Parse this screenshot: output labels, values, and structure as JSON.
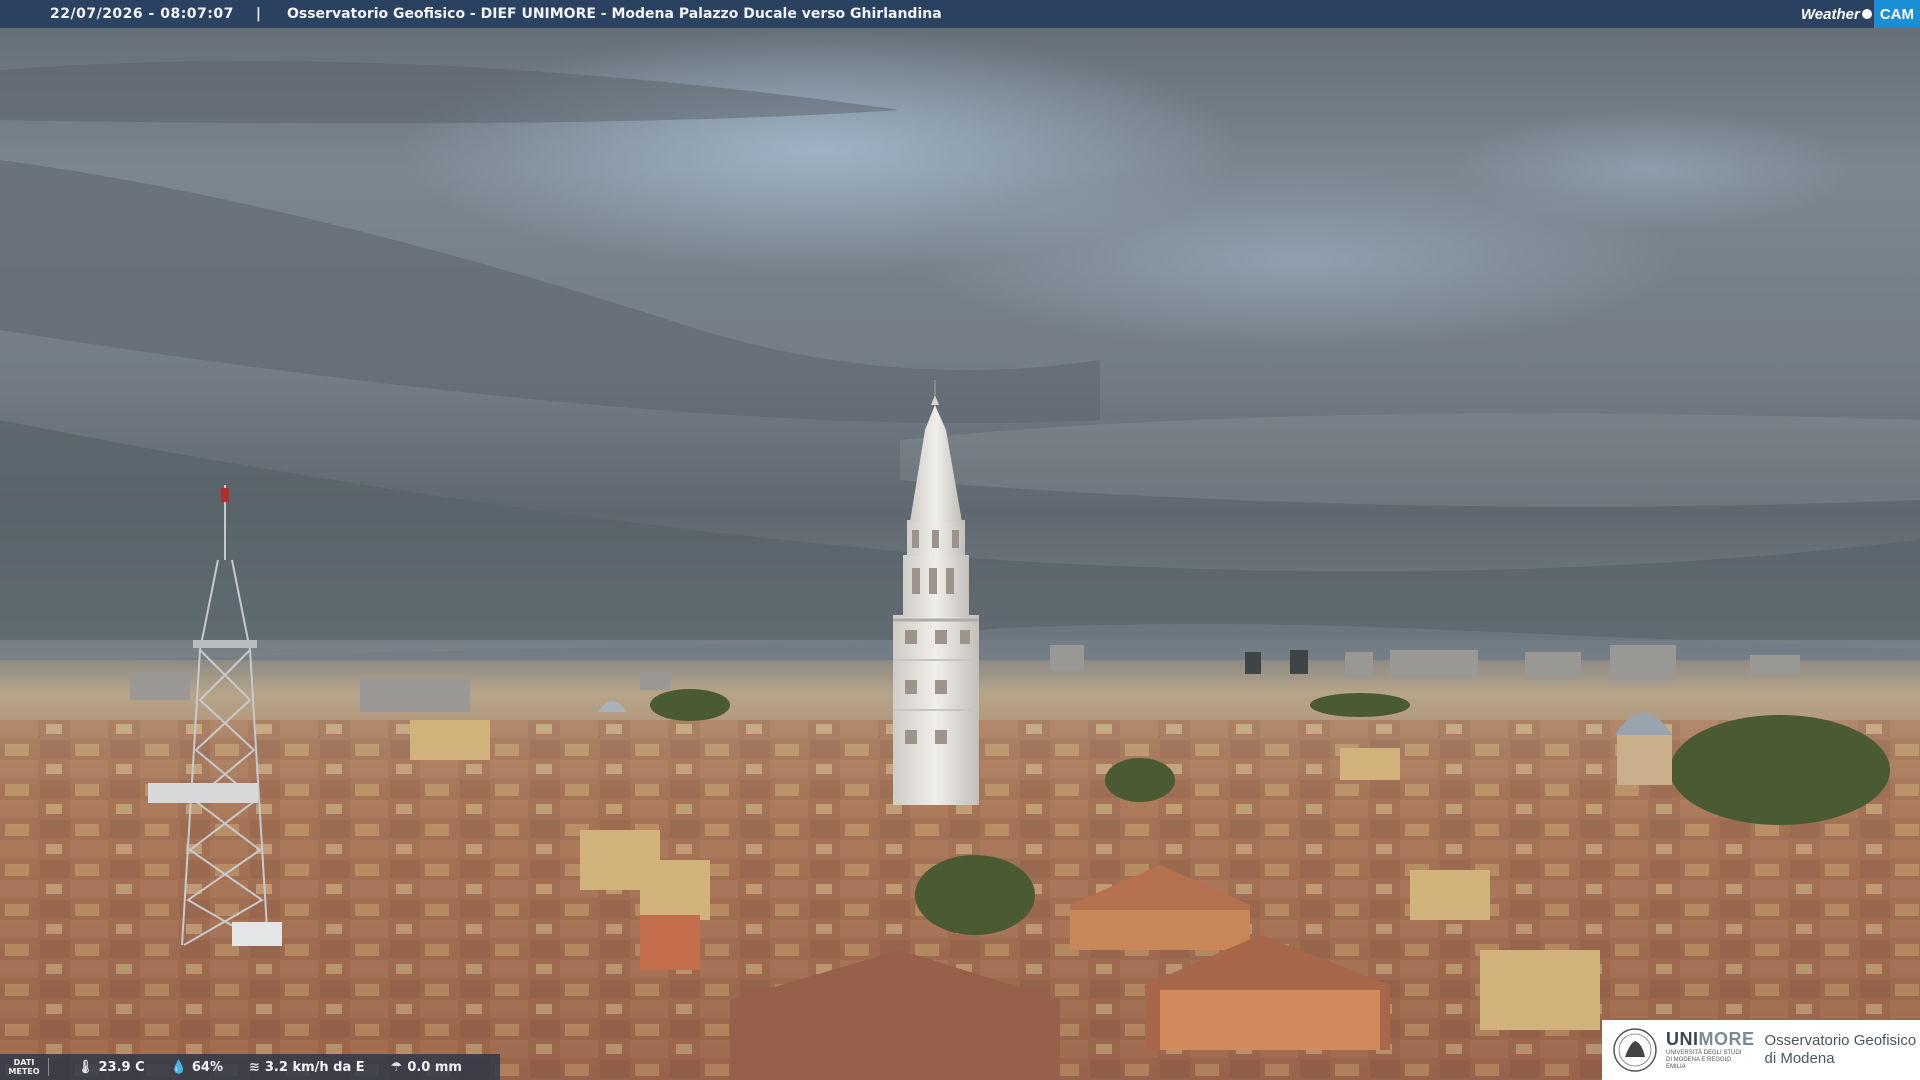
{
  "header": {
    "timestamp": "22/07/2026 - 08:07:07",
    "separator": "|",
    "title": "Osservatorio Geofisico - DIEF UNIMORE - Modena Palazzo Ducale verso Ghirlandina"
  },
  "logo": {
    "word1": "Weather",
    "word2": "CAM",
    "accent_color": "#1b8fd6"
  },
  "meteo": {
    "label_line1": "DATI",
    "label_line2": "METEO",
    "temperature": "23.9 C",
    "humidity": "64%",
    "wind": "3.2 km/h da E",
    "rain": "0.0 mm",
    "icons": [
      "thermometer-icon",
      "humidity-drop-icon",
      "wind-icon",
      "rain-icon"
    ]
  },
  "institution": {
    "brand_part1": "UNI",
    "brand_part2": "MORE",
    "brand_sub": "UNIVERSITÀ DEGLI STUDI DI MODENA E REGGIO EMILIA",
    "observatory_line1": "Osservatorio Geofisico",
    "observatory_line2": "di Modena"
  },
  "colors": {
    "sky_top": "#6c7680",
    "sky_blue": "#9db3c6",
    "roof": "#a1684e",
    "tower": "#e8e6e2",
    "bar": "#263e60"
  }
}
